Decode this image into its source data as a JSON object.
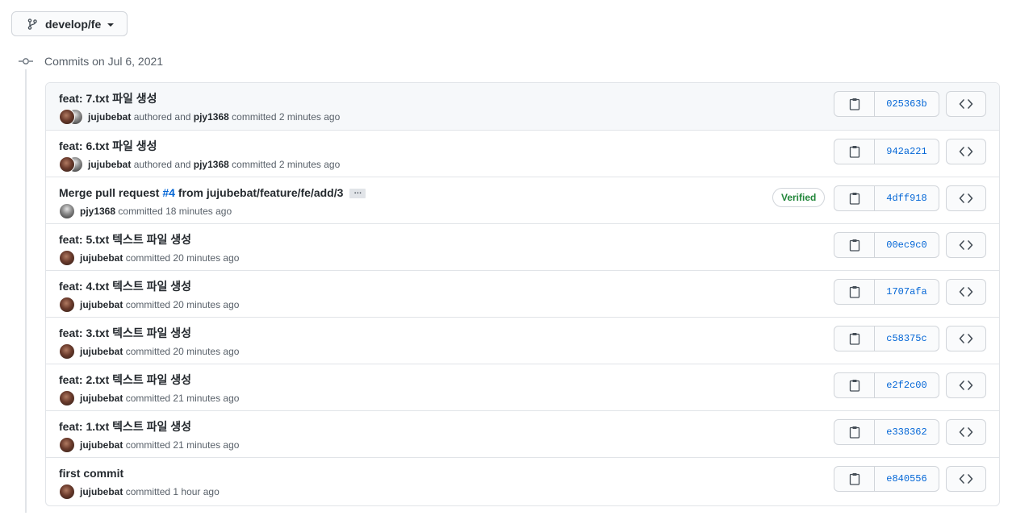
{
  "branch": {
    "name": "develop/fe",
    "icon": "git-branch-icon"
  },
  "group": {
    "title": "Commits on Jul 6, 2021"
  },
  "labels": {
    "authored": "authored and",
    "committed": "committed",
    "verified": "Verified",
    "ellipsis": "…"
  },
  "colors": {
    "link": "#0366d6",
    "verified": "#22863a",
    "border": "#e1e4e8",
    "muted": "#586069"
  },
  "commits": [
    {
      "title": "feat: 7.txt 파일 생성",
      "author": "jujubebat",
      "committer": "pjy1368",
      "time": "2 minutes ago",
      "sha": "025363b"
    },
    {
      "title": "feat: 6.txt 파일 생성",
      "author": "jujubebat",
      "committer": "pjy1368",
      "time": "2 minutes ago",
      "sha": "942a221"
    },
    {
      "title_prefix": "Merge pull request ",
      "pr": "#4",
      "title_suffix": " from jujubebat/feature/fe/add/3",
      "committer": "pjy1368",
      "time": "18 minutes ago",
      "sha": "4dff918",
      "verified": true
    },
    {
      "title": "feat: 5.txt 텍스트 파일 생성",
      "committer": "jujubebat",
      "time": "20 minutes ago",
      "sha": "00ec9c0"
    },
    {
      "title": "feat: 4.txt 텍스트 파일 생성",
      "committer": "jujubebat",
      "time": "20 minutes ago",
      "sha": "1707afa"
    },
    {
      "title": "feat: 3.txt 텍스트 파일 생성",
      "committer": "jujubebat",
      "time": "20 minutes ago",
      "sha": "c58375c"
    },
    {
      "title": "feat: 2.txt 텍스트 파일 생성",
      "committer": "jujubebat",
      "time": "21 minutes ago",
      "sha": "e2f2c00"
    },
    {
      "title": "feat: 1.txt 텍스트 파일 생성",
      "committer": "jujubebat",
      "time": "21 minutes ago",
      "sha": "e338362"
    },
    {
      "title": "first commit",
      "committer": "jujubebat",
      "time": "1 hour ago",
      "sha": "e840556"
    }
  ]
}
